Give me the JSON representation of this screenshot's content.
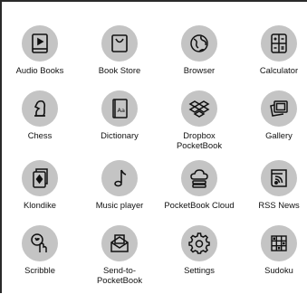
{
  "apps": [
    {
      "label": "Audio Books",
      "icon": "audiobook-icon"
    },
    {
      "label": "Book Store",
      "icon": "bookstore-icon"
    },
    {
      "label": "Browser",
      "icon": "globe-icon"
    },
    {
      "label": "Calculator",
      "icon": "calculator-icon"
    },
    {
      "label": "Chess",
      "icon": "chess-knight-icon"
    },
    {
      "label": "Dictionary",
      "icon": "dictionary-icon"
    },
    {
      "label": "Dropbox\nPocketBook",
      "icon": "dropbox-icon"
    },
    {
      "label": "Gallery",
      "icon": "gallery-icon"
    },
    {
      "label": "Klondike",
      "icon": "playing-card-icon"
    },
    {
      "label": "Music player",
      "icon": "music-note-icon"
    },
    {
      "label": "PocketBook Cloud",
      "icon": "cloud-icon"
    },
    {
      "label": "RSS News",
      "icon": "rss-icon"
    },
    {
      "label": "Scribble",
      "icon": "scribble-icon"
    },
    {
      "label": "Send-to-\nPocketBook",
      "icon": "envelope-icon"
    },
    {
      "label": "Settings",
      "icon": "gear-icon"
    },
    {
      "label": "Sudoku",
      "icon": "sudoku-grid-icon"
    }
  ]
}
